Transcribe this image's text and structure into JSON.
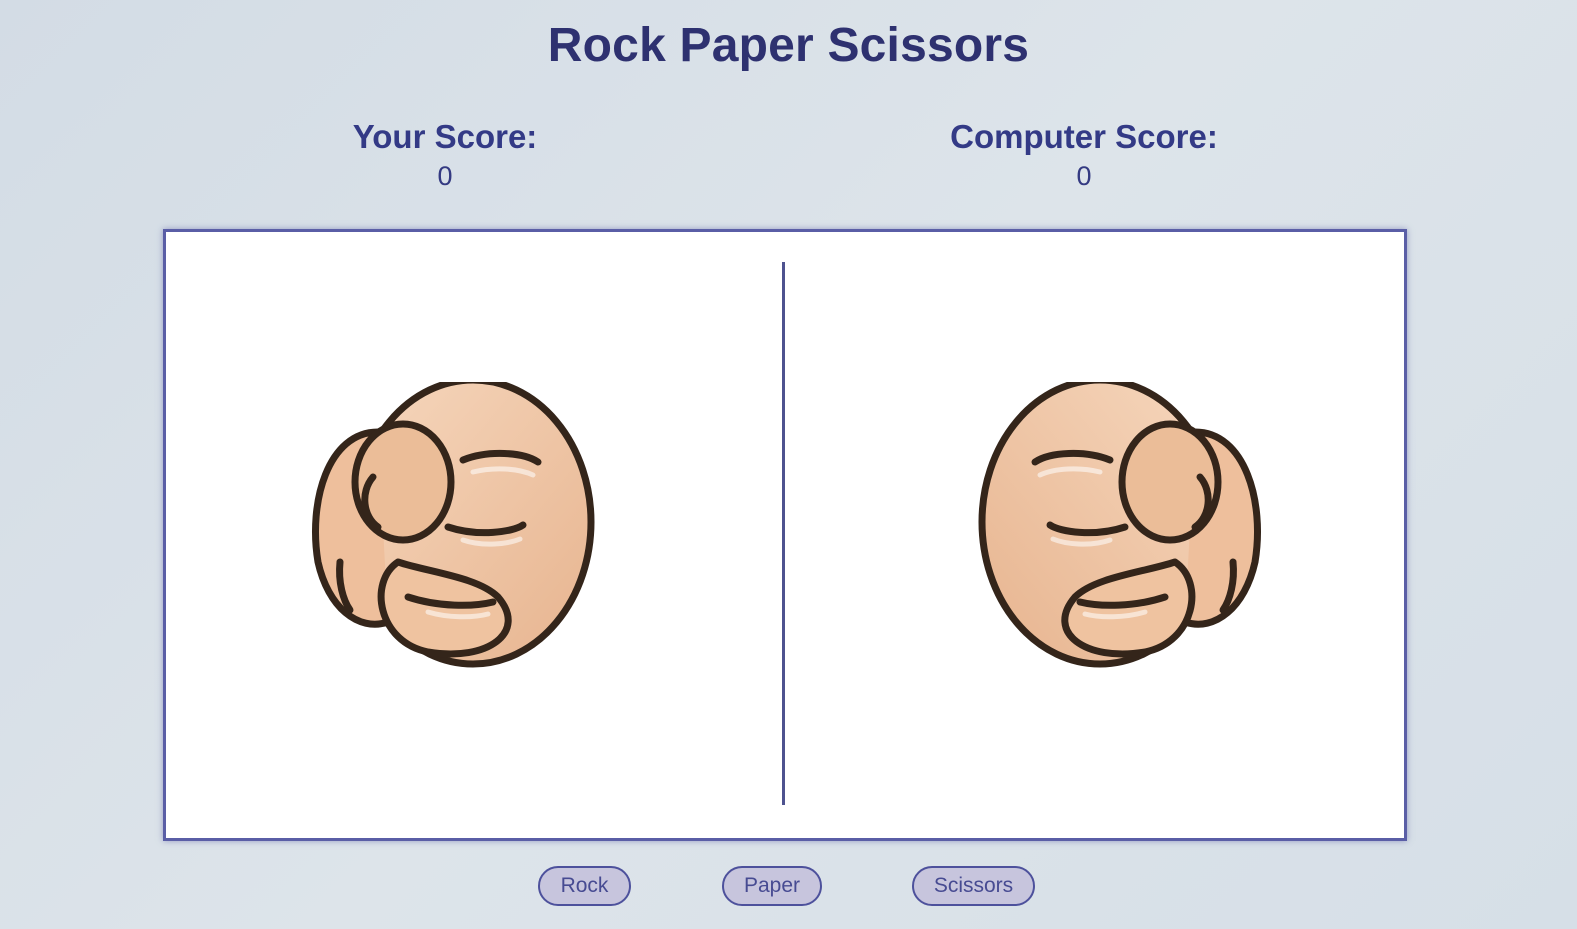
{
  "title": "Rock Paper Scissors",
  "scores": {
    "player_label": "Your Score:",
    "player_value": "0",
    "computer_label": "Computer Score:",
    "computer_value": "0"
  },
  "arena": {
    "player_hand_icon": "rock-fist-icon",
    "computer_hand_icon": "rock-fist-icon"
  },
  "buttons": {
    "rock": "Rock",
    "paper": "Paper",
    "scissors": "Scissors"
  },
  "colors": {
    "accent": "#2f3276",
    "border": "#5a5ea6",
    "button_fill": "#c7c5dd",
    "skin": "#f0c9a8",
    "outline": "#3a2a1e"
  }
}
